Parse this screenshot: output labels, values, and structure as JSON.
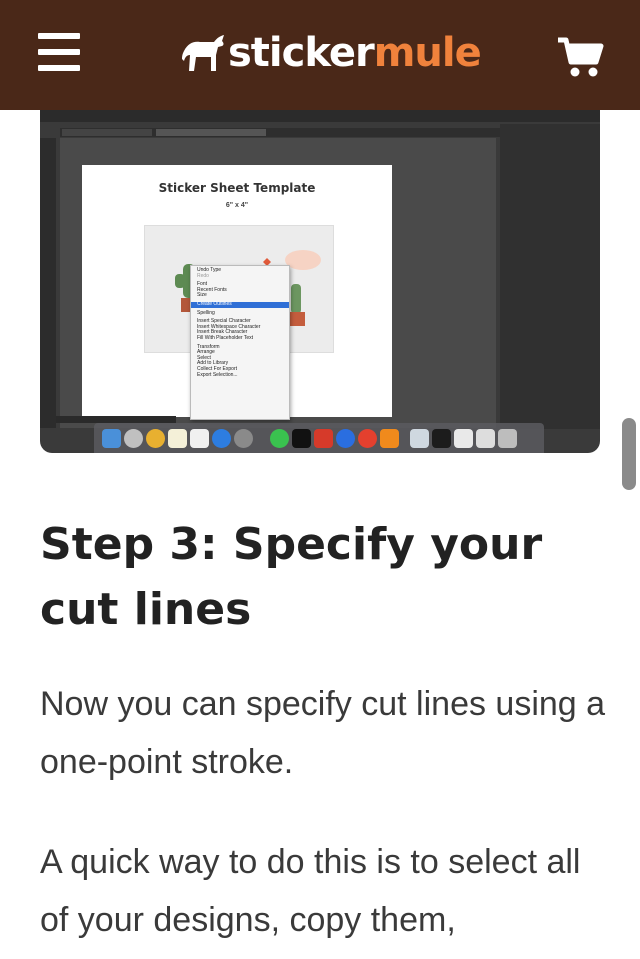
{
  "header": {
    "logo_text_1": "sticker",
    "logo_text_2": "mule",
    "brand_bg": "#4a2818",
    "accent": "#f0823c",
    "menu_icon": "hamburger-menu-icon",
    "cart_icon": "shopping-cart-icon"
  },
  "screenshot": {
    "sheet_title": "Sticker Sheet Template",
    "sheet_size": "6\" x 4\"",
    "context_menu": [
      "Undo Type",
      "Redo",
      "Font",
      "Recent Fonts",
      "Size",
      "Create Outlines",
      "Spelling",
      "Insert Special Character",
      "Insert Whitespace Character",
      "Insert Break Character",
      "Fill With Placeholder Text",
      "Transform",
      "Arrange",
      "Select",
      "Add to Library",
      "Collect For Export",
      "Export Selection..."
    ],
    "highlighted_item": "Create Outlines"
  },
  "article": {
    "heading": "Step 3: Specify your cut lines",
    "paragraph_1": "Now you can specify cut lines using a one-point stroke.",
    "paragraph_2": "A quick way to do this is to select all of your designs, copy them,"
  }
}
